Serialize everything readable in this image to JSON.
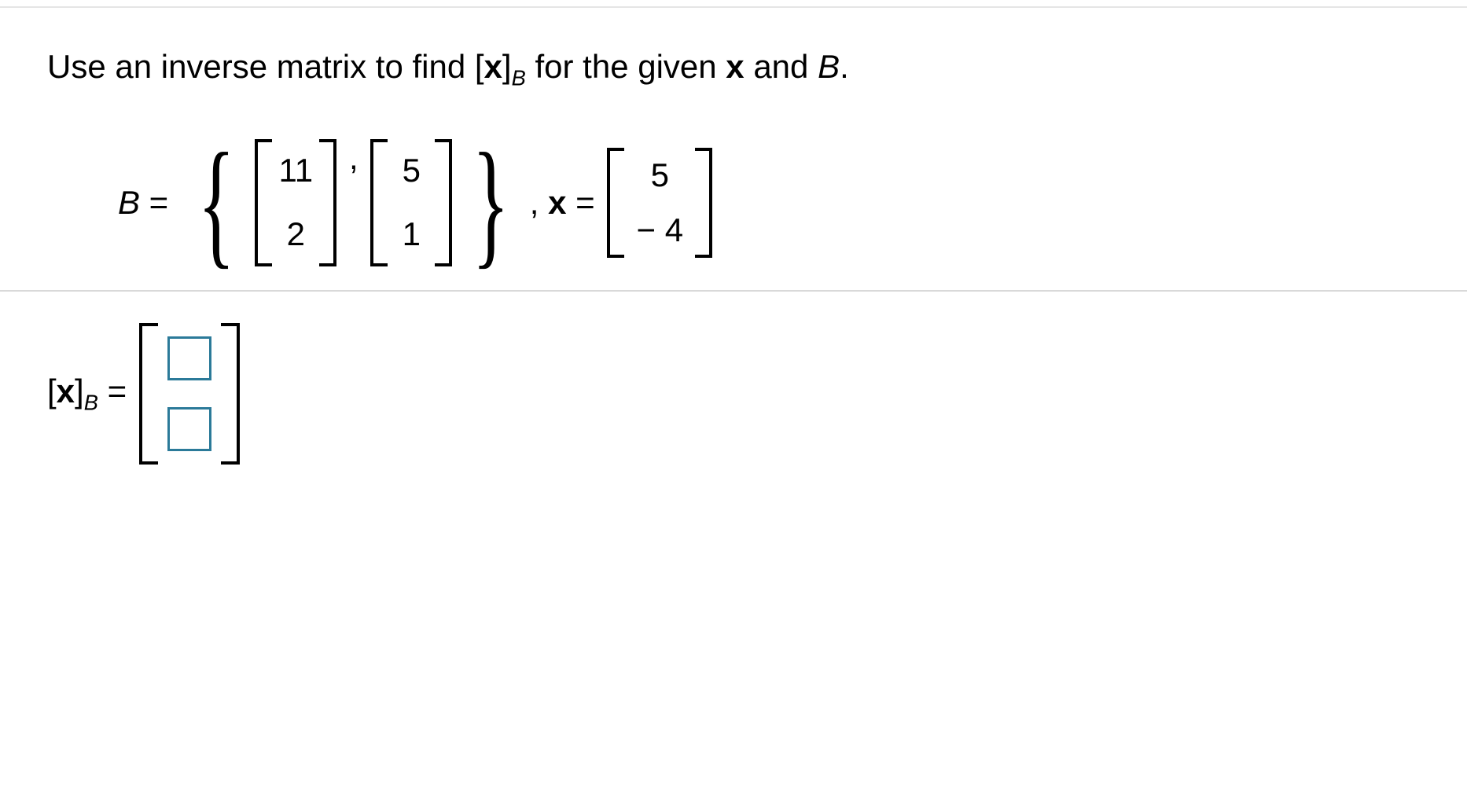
{
  "prompt": {
    "pre": "Use an inverse matrix to find [",
    "xbold": "x",
    "closebracket": "]",
    "subB": "B",
    "mid": " for the given ",
    "xbold2": "x",
    "and": " and ",
    "Bital": "B",
    "period": "."
  },
  "givens": {
    "B_label": "B",
    "equals": " = ",
    "B_vec1": {
      "r1": "11",
      "r2": "2"
    },
    "B_vec2": {
      "r1": "5",
      "r2": "1"
    },
    "comma_gap": " ,  ",
    "x_label": "x",
    "x_vec": {
      "r1": "5",
      "r2": "− 4"
    }
  },
  "answer": {
    "open": "[",
    "xbold": "x",
    "close": "]",
    "subB": "B",
    "equals": " = ",
    "input1": "",
    "input2": ""
  }
}
